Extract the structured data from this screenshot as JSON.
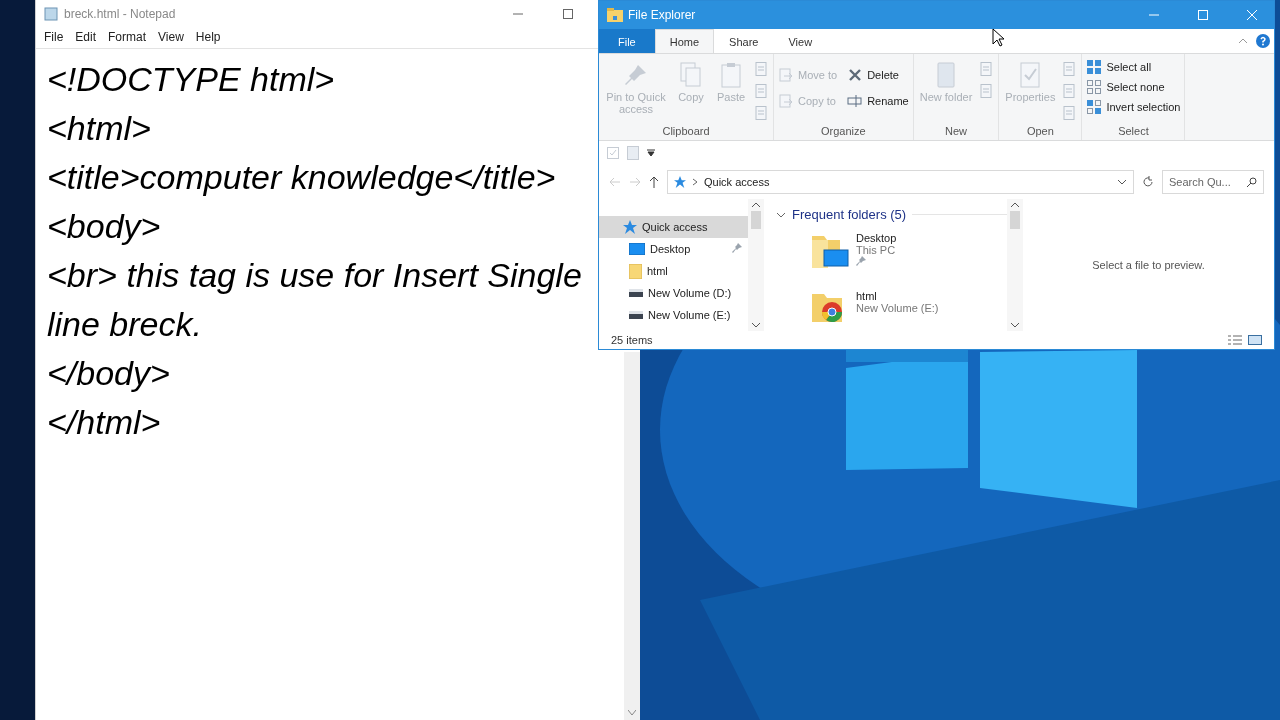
{
  "notepad": {
    "title": "breck.html - Notepad",
    "menu": [
      "File",
      "Edit",
      "Format",
      "View",
      "Help"
    ],
    "lines": [
      "<!DOCTYPE html>",
      "<html>",
      "<title>computer knowledge</title>",
      "<body>",
      "<br> this tag is use for Insert Single line breck.",
      "</body>",
      "</html>"
    ]
  },
  "explorer": {
    "title": "File Explorer",
    "tabs": [
      {
        "label": "File",
        "selected": false,
        "kind": "file"
      },
      {
        "label": "Home",
        "selected": true,
        "kind": "tab"
      },
      {
        "label": "Share",
        "selected": false,
        "kind": "tab"
      },
      {
        "label": "View",
        "selected": false,
        "kind": "tab"
      }
    ],
    "ribbon": [
      {
        "label": "Clipboard",
        "items": [
          {
            "label": "Pin to Quick access",
            "kind": "large",
            "disabled": true
          },
          {
            "label": "Copy",
            "kind": "large",
            "disabled": true
          },
          {
            "label": "Paste",
            "kind": "large",
            "disabled": true
          }
        ]
      },
      {
        "label": "Organize",
        "items": [
          {
            "label": "Move to",
            "kind": "small",
            "disabled": true
          },
          {
            "label": "Copy to",
            "kind": "small",
            "disabled": true
          },
          {
            "label": "Delete",
            "kind": "small",
            "disabled": false
          },
          {
            "label": "Rename",
            "kind": "small",
            "disabled": false
          }
        ]
      },
      {
        "label": "New",
        "items": [
          {
            "label": "New folder",
            "kind": "large",
            "disabled": true
          }
        ]
      },
      {
        "label": "Open",
        "items": [
          {
            "label": "Properties",
            "kind": "large",
            "disabled": true
          }
        ]
      },
      {
        "label": "Select",
        "items": [
          {
            "label": "Select all",
            "kind": "small",
            "disabled": false
          },
          {
            "label": "Select none",
            "kind": "small",
            "disabled": false
          },
          {
            "label": "Invert selection",
            "kind": "small",
            "disabled": false
          }
        ]
      }
    ],
    "address": "Quick access",
    "search_placeholder": "Search Qu...",
    "nav": [
      {
        "label": "Quick access",
        "selected": true,
        "pinned": false,
        "kind": "star"
      },
      {
        "label": "Desktop",
        "selected": false,
        "pinned": true,
        "kind": "desktop"
      },
      {
        "label": "html",
        "selected": false,
        "pinned": false,
        "kind": "folder"
      },
      {
        "label": "New Volume (D:)",
        "selected": false,
        "pinned": false,
        "kind": "drive"
      },
      {
        "label": "New Volume (E:)",
        "selected": false,
        "pinned": false,
        "kind": "drive"
      }
    ],
    "section": "Frequent folders (5)",
    "folders": [
      {
        "name": "Desktop",
        "location": "This PC",
        "pinned": true,
        "kind": "desktop"
      },
      {
        "name": "html",
        "location": "New Volume (E:)",
        "pinned": false,
        "kind": "web"
      }
    ],
    "preview": "Select a file to preview.",
    "status": "25 items"
  }
}
